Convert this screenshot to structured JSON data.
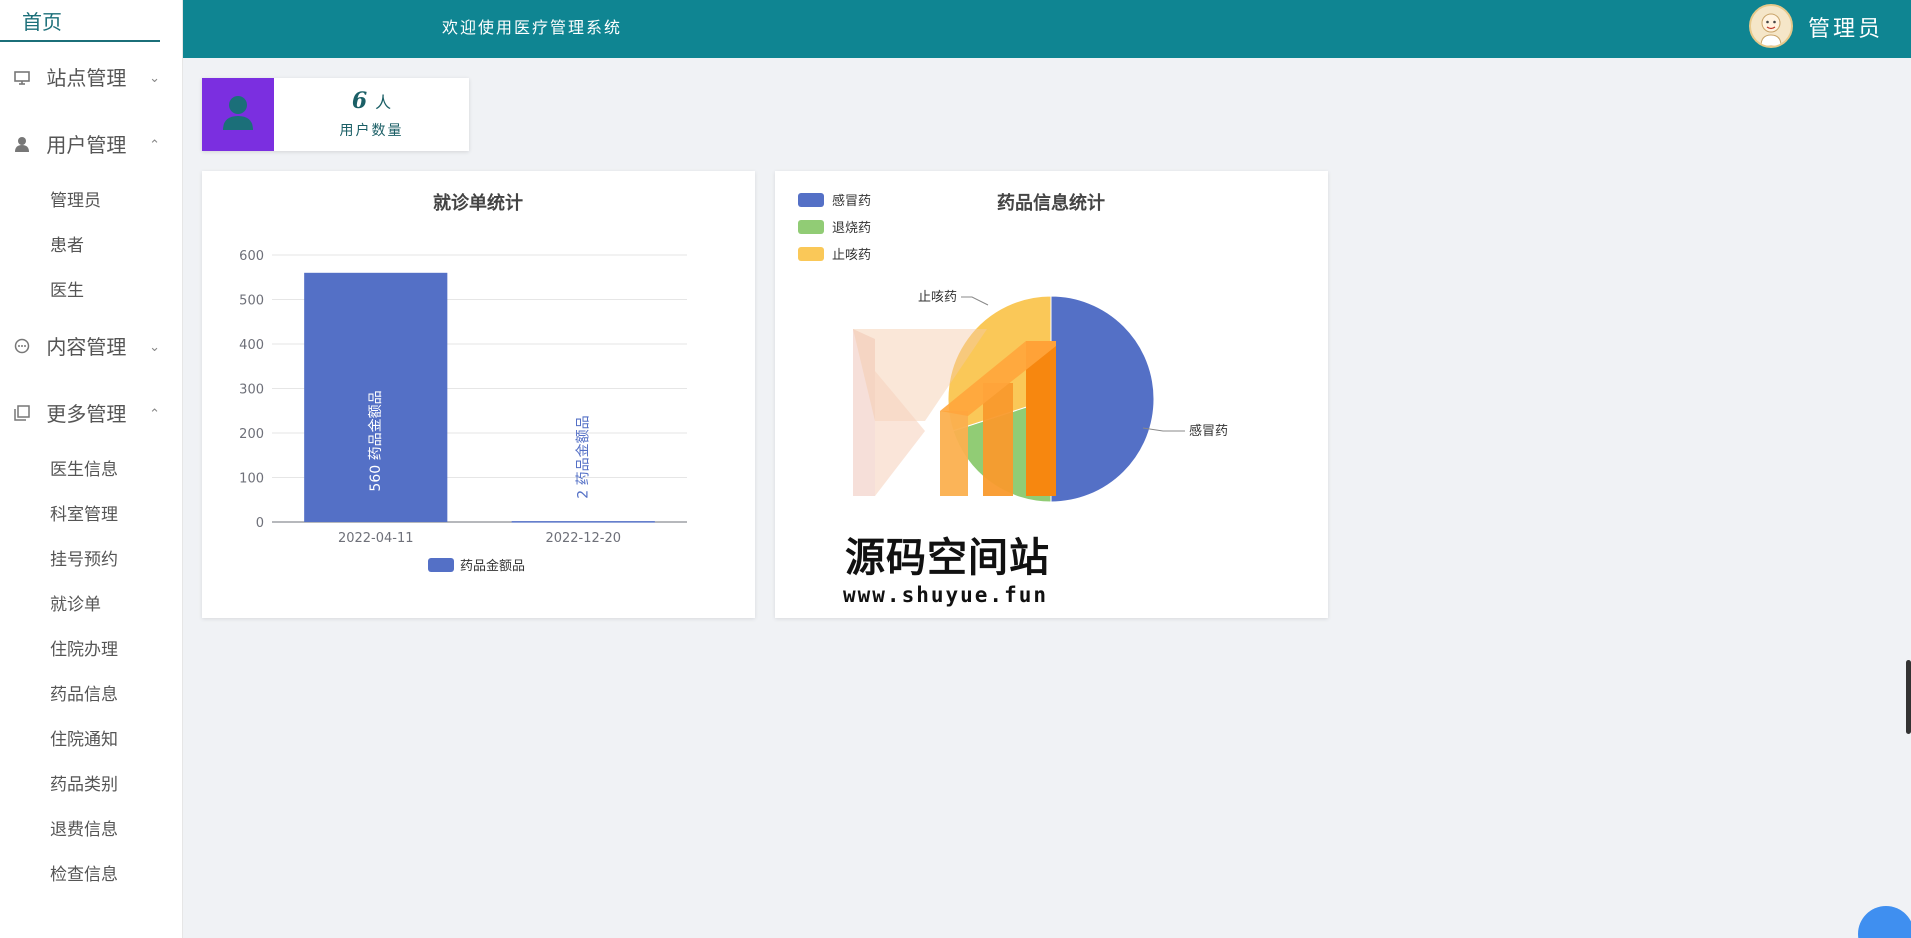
{
  "sidebar": {
    "home": "首页",
    "groups": [
      {
        "label": "站点管理",
        "icon": "monitor-icon",
        "chevron": "⌄"
      },
      {
        "label": "用户管理",
        "icon": "user-icon",
        "chevron": "⌃",
        "items": [
          "管理员",
          "患者",
          "医生"
        ]
      },
      {
        "label": "内容管理",
        "icon": "chat-icon",
        "chevron": "⌄"
      },
      {
        "label": "更多管理",
        "icon": "copy-icon",
        "chevron": "⌃",
        "items": [
          "医生信息",
          "科室管理",
          "挂号预约",
          "就诊单",
          "住院办理",
          "药品信息",
          "住院通知",
          "药品类别",
          "退费信息",
          "检查信息"
        ]
      }
    ]
  },
  "header": {
    "welcome": "欢迎使用医疗管理系统",
    "username": "管理员",
    "bg_color": "#0f8592"
  },
  "stat": {
    "value": "6",
    "unit": "人",
    "label": "用户数量",
    "accent": "#7b2fe0"
  },
  "chart_data": [
    {
      "type": "bar",
      "title": "就诊单统计",
      "categories": [
        "2022-04-11",
        "2022-12-20"
      ],
      "series": [
        {
          "name": "药品金额品",
          "values": [
            560,
            2
          ],
          "color": "#5470c6"
        }
      ],
      "ylim": [
        0,
        600
      ],
      "yticks": [
        0,
        100,
        200,
        300,
        400,
        500,
        600
      ],
      "data_labels": [
        "560  药品金额品",
        "2  药品金额品"
      ],
      "legend": "bottom",
      "grid": true
    },
    {
      "type": "pie",
      "title": "药品信息统计",
      "slices": [
        {
          "name": "感冒药",
          "value": 50,
          "color": "#5470c6"
        },
        {
          "name": "退烧药",
          "value": 20,
          "color": "#91cc75"
        },
        {
          "name": "止咳药",
          "value": 30,
          "color": "#fac858"
        }
      ],
      "legend": "top-left",
      "labels_shown": [
        "止咳药",
        "感冒药"
      ]
    }
  ],
  "watermark": {
    "title": "源码空间站",
    "url": "www.shuyue.fun"
  }
}
